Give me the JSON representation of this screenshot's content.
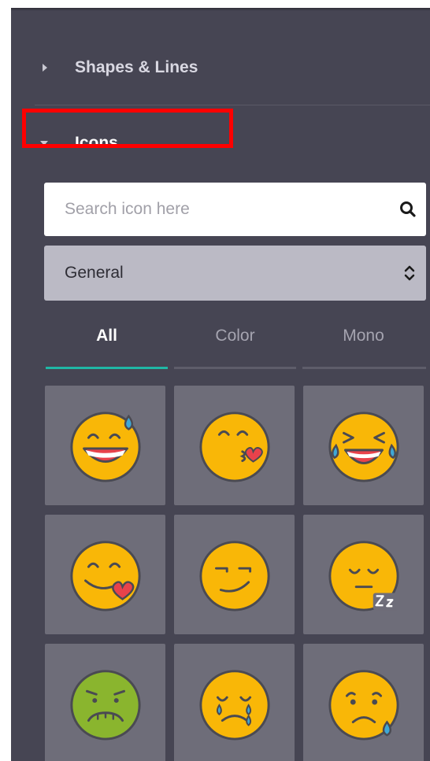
{
  "sections": {
    "shapes_lines": {
      "label": "Shapes & Lines",
      "expanded": false
    },
    "icons": {
      "label": "Icons",
      "expanded": true
    }
  },
  "search": {
    "placeholder": "Search icon here",
    "value": "",
    "icon": "search-icon"
  },
  "category_select": {
    "selected": "General",
    "icon": "chevron-up-down-icon"
  },
  "tabs": [
    {
      "label": "All",
      "active": true
    },
    {
      "label": "Color",
      "active": false
    },
    {
      "label": "Mono",
      "active": false
    }
  ],
  "icon_grid": [
    {
      "name": "grinning-sweat-emoji-icon"
    },
    {
      "name": "kissing-heart-emoji-icon"
    },
    {
      "name": "tears-of-joy-emoji-icon"
    },
    {
      "name": "heart-eyes-smile-emoji-icon"
    },
    {
      "name": "smirking-emoji-icon"
    },
    {
      "name": "sleeping-emoji-icon"
    },
    {
      "name": "nauseated-emoji-icon"
    },
    {
      "name": "crying-emoji-icon"
    },
    {
      "name": "sad-sweat-emoji-icon"
    }
  ],
  "colors": {
    "panel_bg": "#464553",
    "tab_accent": "#20b7a5",
    "emoji_yellow": "#f9b707",
    "emoji_green": "#8ab52e",
    "highlight_red": "#ff0000"
  }
}
